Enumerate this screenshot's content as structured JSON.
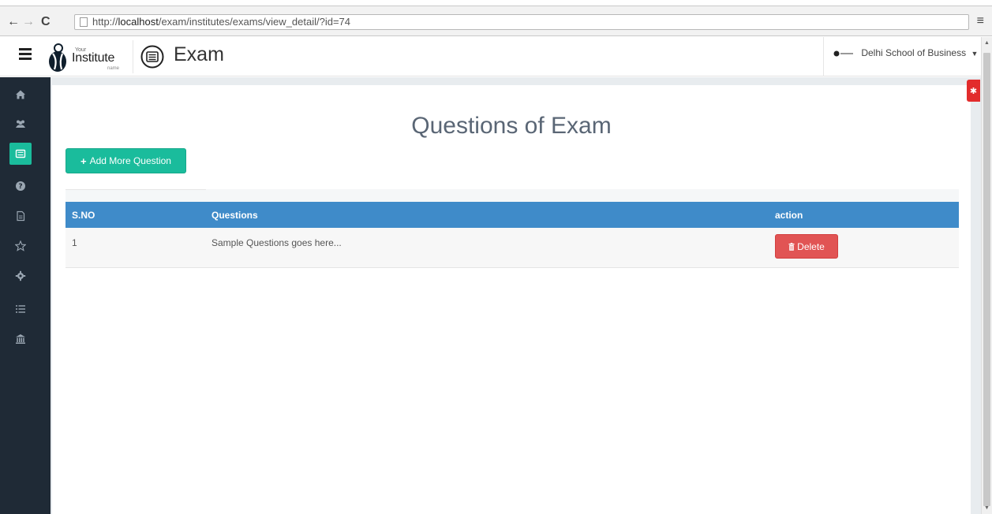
{
  "browser": {
    "url_prefix": "http://",
    "url_host": "localhost",
    "url_path": "/exam/institutes/exams/view_detail/?id=74"
  },
  "header": {
    "logo_small_top": "Your",
    "logo_main": "Institute",
    "logo_small_bottom": "name",
    "title": "Exam",
    "institution": "Delhi School of Business"
  },
  "sidebar": {
    "items": [
      {
        "icon": "home-icon",
        "active": false
      },
      {
        "icon": "users-icon",
        "active": false
      },
      {
        "icon": "exam-list-icon",
        "active": true
      },
      {
        "icon": "question-icon",
        "active": false
      },
      {
        "icon": "document-icon",
        "active": false
      },
      {
        "icon": "star-icon",
        "active": false
      },
      {
        "icon": "gear-icon",
        "active": false
      },
      {
        "icon": "list-icon",
        "active": false
      },
      {
        "icon": "institution-icon",
        "active": false
      }
    ]
  },
  "main": {
    "title": "Questions of Exam",
    "add_button_label": "Add More Question",
    "table": {
      "headers": [
        "S.NO",
        "Questions",
        "action"
      ],
      "rows": [
        {
          "sno": "1",
          "question": "Sample Questions goes here...",
          "action": "Delete"
        }
      ]
    }
  },
  "colors": {
    "sidebar": "#1f2a36",
    "accent": "#1abc9c",
    "table_header": "#3f8bc9",
    "danger": "#e15454"
  }
}
